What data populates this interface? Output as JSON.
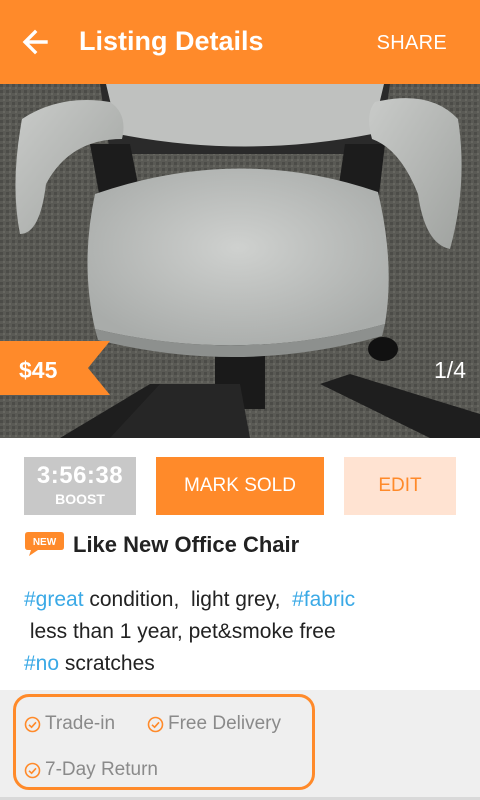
{
  "header": {
    "title": "Listing Details",
    "share_label": "SHARE",
    "back_icon": "arrow-left-icon"
  },
  "photo": {
    "price": "$45",
    "counter": "1/4"
  },
  "actions": {
    "boost_time": "3:56:38",
    "boost_label": "BOOST",
    "mark_sold_label": "MARK SOLD",
    "edit_label": "EDIT"
  },
  "listing": {
    "new_badge": "NEW",
    "title": "Like New Office Chair",
    "desc": {
      "tag1": "#great",
      "text1": " condition,  light grey,  ",
      "tag2": "#fabric",
      "line2": " less than 1 year, pet&smoke free",
      "tag3": "#no",
      "text3": " scratches"
    }
  },
  "features": [
    {
      "label": "Trade-in",
      "icon": "check-circle-icon"
    },
    {
      "label": "Free Delivery",
      "icon": "check-circle-icon"
    },
    {
      "label": "7-Day Return",
      "icon": "check-circle-icon"
    }
  ],
  "colors": {
    "accent": "#ff8a2a",
    "accent_light": "#ffe3d2",
    "hashtag": "#3aa9e6",
    "boost_bg": "#c8c8c8"
  }
}
